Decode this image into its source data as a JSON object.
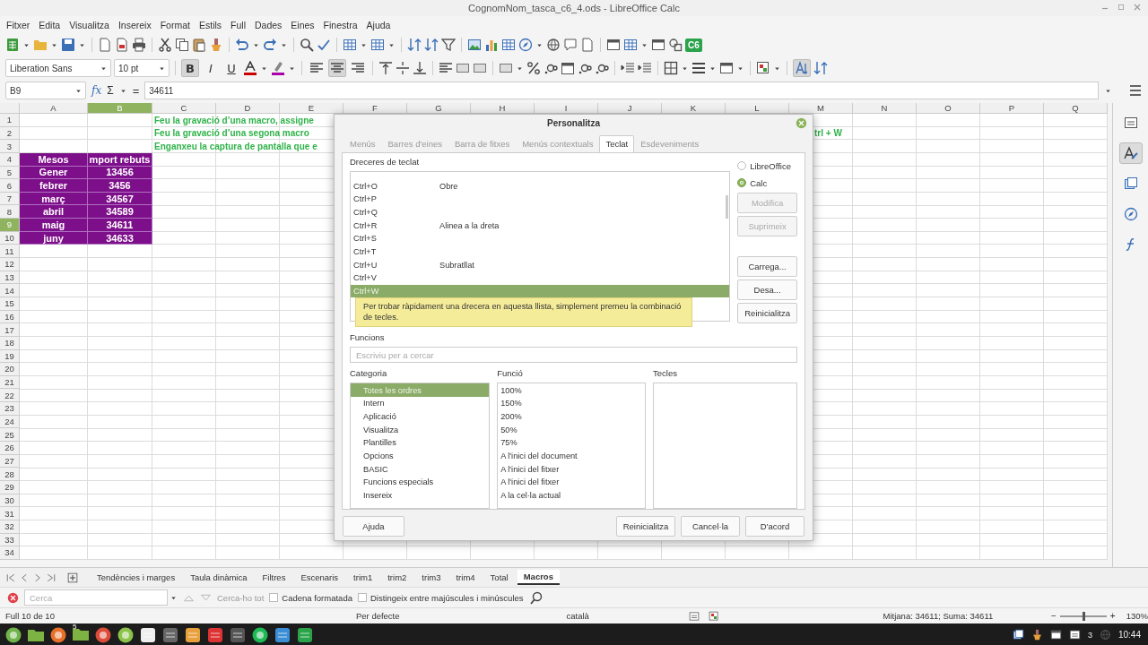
{
  "window": {
    "title": "CognomNom_tasca_c6_4.ods - LibreOffice Calc"
  },
  "menu": [
    "Fitxer",
    "Edita",
    "Visualitza",
    "Insereix",
    "Format",
    "Estils",
    "Full",
    "Dades",
    "Eines",
    "Finestra",
    "Ajuda"
  ],
  "toolbar": {
    "badge": "C6",
    "font_name": "Liberation Sans",
    "font_size": "10 pt",
    "format_buttons": [
      {
        "kind": "bold",
        "label": "B",
        "on": true
      },
      {
        "kind": "italic",
        "label": "I",
        "on": false
      },
      {
        "kind": "underline",
        "label": "U",
        "on": false
      }
    ],
    "align_buttons": [
      {
        "kind": "left",
        "on": false
      },
      {
        "kind": "center",
        "on": true
      },
      {
        "kind": "right",
        "on": false
      }
    ],
    "autofit_button": {
      "on": true
    }
  },
  "formula_bar": {
    "cell_ref": "B9",
    "wizard": "fx",
    "sum": "Σ",
    "equals": "=",
    "content": "34611"
  },
  "sheet": {
    "columns": [
      {
        "label": "A",
        "selected": false
      },
      {
        "label": "B",
        "selected": true
      },
      {
        "label": "C",
        "selected": false
      },
      {
        "label": "D",
        "selected": false
      },
      {
        "label": "E",
        "selected": false
      },
      {
        "label": "F",
        "selected": false
      },
      {
        "label": "G",
        "selected": false
      },
      {
        "label": "H",
        "selected": false
      },
      {
        "label": "I",
        "selected": false
      },
      {
        "label": "J",
        "selected": false
      },
      {
        "label": "K",
        "selected": false
      },
      {
        "label": "L",
        "selected": false
      },
      {
        "label": "M",
        "selected": false
      },
      {
        "label": "N",
        "selected": false
      },
      {
        "label": "O",
        "selected": false
      },
      {
        "label": "P",
        "selected": false
      },
      {
        "label": "Q",
        "selected": false
      }
    ],
    "rows": [
      {
        "header": "1",
        "selected": false,
        "note": "Feu  la gravació d’una macro, assigne"
      },
      {
        "header": "2",
        "selected": false,
        "note": "Feu  la gravació d’una segona macro",
        "note_end": "trl + W"
      },
      {
        "header": "3",
        "selected": false,
        "note": "Enganxeu la captura de pantalla que e"
      },
      {
        "header": "4",
        "selected": false,
        "cells": [
          {
            "text": "Mesos"
          },
          {
            "text": "mport rebuts"
          }
        ]
      },
      {
        "header": "5",
        "selected": false,
        "cells": [
          {
            "text": "Gener"
          },
          {
            "text": "13456"
          }
        ]
      },
      {
        "header": "6",
        "selected": false,
        "cells": [
          {
            "text": "febrer"
          },
          {
            "text": "3456"
          }
        ]
      },
      {
        "header": "7",
        "selected": false,
        "cells": [
          {
            "text": "març"
          },
          {
            "text": "34567"
          }
        ]
      },
      {
        "header": "8",
        "selected": false,
        "cells": [
          {
            "text": "abril"
          },
          {
            "text": "34589"
          }
        ]
      },
      {
        "header": "9",
        "selected": true,
        "cells": [
          {
            "text": "maig"
          },
          {
            "text": "34611"
          }
        ]
      },
      {
        "header": "10",
        "selected": false,
        "cells": [
          {
            "text": "juny"
          },
          {
            "text": "34633"
          }
        ]
      },
      {
        "header": "11",
        "selected": false
      },
      {
        "header": "12",
        "selected": false
      },
      {
        "header": "13",
        "selected": false
      },
      {
        "header": "14",
        "selected": false
      },
      {
        "header": "15",
        "selected": false
      },
      {
        "header": "16",
        "selected": false
      },
      {
        "header": "17",
        "selected": false
      },
      {
        "header": "18",
        "selected": false
      },
      {
        "header": "19",
        "selected": false
      },
      {
        "header": "20",
        "selected": false
      },
      {
        "header": "21",
        "selected": false
      },
      {
        "header": "22",
        "selected": false
      },
      {
        "header": "23",
        "selected": false
      },
      {
        "header": "24",
        "selected": false
      },
      {
        "header": "25",
        "selected": false
      },
      {
        "header": "26",
        "selected": false
      },
      {
        "header": "27",
        "selected": false
      },
      {
        "header": "28",
        "selected": false
      },
      {
        "header": "29",
        "selected": false
      },
      {
        "header": "30",
        "selected": false
      },
      {
        "header": "31",
        "selected": false
      },
      {
        "header": "32",
        "selected": false
      },
      {
        "header": "33",
        "selected": false
      },
      {
        "header": "34",
        "selected": false
      }
    ]
  },
  "sidebar": [
    {
      "kind": "properties",
      "selected": false
    },
    {
      "kind": "styles",
      "selected": true
    },
    {
      "kind": "gallery",
      "selected": false
    },
    {
      "kind": "navigator",
      "selected": false
    },
    {
      "kind": "functions",
      "selected": false
    }
  ],
  "dialog": {
    "title": "Personalitza",
    "tabs": [
      {
        "label": "Menús",
        "selected": false
      },
      {
        "label": "Barres d'eines",
        "selected": false
      },
      {
        "label": "Barra de fitxes",
        "selected": false
      },
      {
        "label": "Menús contextuals",
        "selected": false
      },
      {
        "label": "Teclat",
        "selected": true
      },
      {
        "label": "Esdeveniments",
        "selected": false
      }
    ],
    "shortcuts_label": "Dreceres de teclat",
    "shortcuts": [
      {
        "key": "Ctrl+O",
        "function": "Obre",
        "selected": false
      },
      {
        "key": "Ctrl+P",
        "selected": false
      },
      {
        "key": "Ctrl+Q",
        "selected": false
      },
      {
        "key": "Ctrl+R",
        "function": "Alinea a la dreta",
        "selected": false
      },
      {
        "key": "Ctrl+S",
        "selected": false
      },
      {
        "key": "Ctrl+T",
        "selected": false
      },
      {
        "key": "Ctrl+U",
        "function": "Subratllat",
        "selected": false
      },
      {
        "key": "Ctrl+V",
        "selected": false
      },
      {
        "key": "Ctrl+W",
        "selected": true
      }
    ],
    "tooltip": "Per trobar ràpidament una drecera en aquesta llista, simplement premeu la combinació de tecles.",
    "scope": [
      {
        "label": "LibreOffice",
        "selected": false
      },
      {
        "label": "Calc",
        "selected": true
      }
    ],
    "edit_buttons": [
      {
        "label": "Modifica",
        "disabled": true
      },
      {
        "label": "Suprimeix",
        "disabled": true
      }
    ],
    "file_buttons": [
      {
        "label": "Carrega...",
        "disabled": false
      },
      {
        "label": "Desa...",
        "disabled": false
      },
      {
        "label": "Reinicialitza",
        "disabled": false
      }
    ],
    "functions_label": "Funcions",
    "search": {
      "placeholder": "Escriviu per a cercar"
    },
    "category_label": "Categoria",
    "categories": [
      {
        "label": "Totes les ordres",
        "selected": true
      },
      {
        "label": "Intern",
        "selected": false
      },
      {
        "label": "Aplicació",
        "selected": false
      },
      {
        "label": "Visualitza",
        "selected": false
      },
      {
        "label": "Plantilles",
        "selected": false
      },
      {
        "label": "Opcions",
        "selected": false
      },
      {
        "label": "BASIC",
        "selected": false
      },
      {
        "label": "Funcions especials",
        "selected": false
      },
      {
        "label": "Insereix",
        "selected": false
      }
    ],
    "function_label": "Funció",
    "functions": [
      "100%",
      "150%",
      "200%",
      "50%",
      "75%",
      "A l'inici del document",
      "A l'inici del fitxer",
      "A l'inici del fitxer",
      "A la cel·la actual"
    ],
    "keys_label": "Tecles",
    "help_button": "Ajuda",
    "footer_buttons": [
      "Reinicialitza",
      "Cancel·la",
      "D'acord"
    ]
  },
  "sheet_tabs": [
    {
      "label": "Tendències i marges",
      "selected": false
    },
    {
      "label": "Taula dinàmica",
      "selected": false
    },
    {
      "label": "Filtres",
      "selected": false
    },
    {
      "label": "Escenaris",
      "selected": false
    },
    {
      "label": "trim1",
      "selected": false
    },
    {
      "label": "trim2",
      "selected": false
    },
    {
      "label": "trim3",
      "selected": false
    },
    {
      "label": "trim4",
      "selected": false
    },
    {
      "label": "Total",
      "selected": false
    },
    {
      "label": "Macros",
      "selected": true
    }
  ],
  "find_bar": {
    "placeholder": "Cerca",
    "find_all": {
      "label": "Cerca-ho tot",
      "disabled": true
    },
    "options": [
      {
        "label": "Cadena formatada",
        "checked": false
      },
      {
        "label": "Distingeix entre majúscules i minúscules",
        "checked": false
      }
    ]
  },
  "status_bar": {
    "sheet": "Full 10 de 10",
    "page_style": "Per defecte",
    "language": "català",
    "selection": "Mitjana: 34611; Suma: 34611",
    "zoom": {
      "minus": "−",
      "plus": "+",
      "level": 0.5,
      "value": "130%"
    }
  },
  "taskbar": {
    "folder_badge": "5",
    "tray_count": "3",
    "clock": "10:44"
  }
}
